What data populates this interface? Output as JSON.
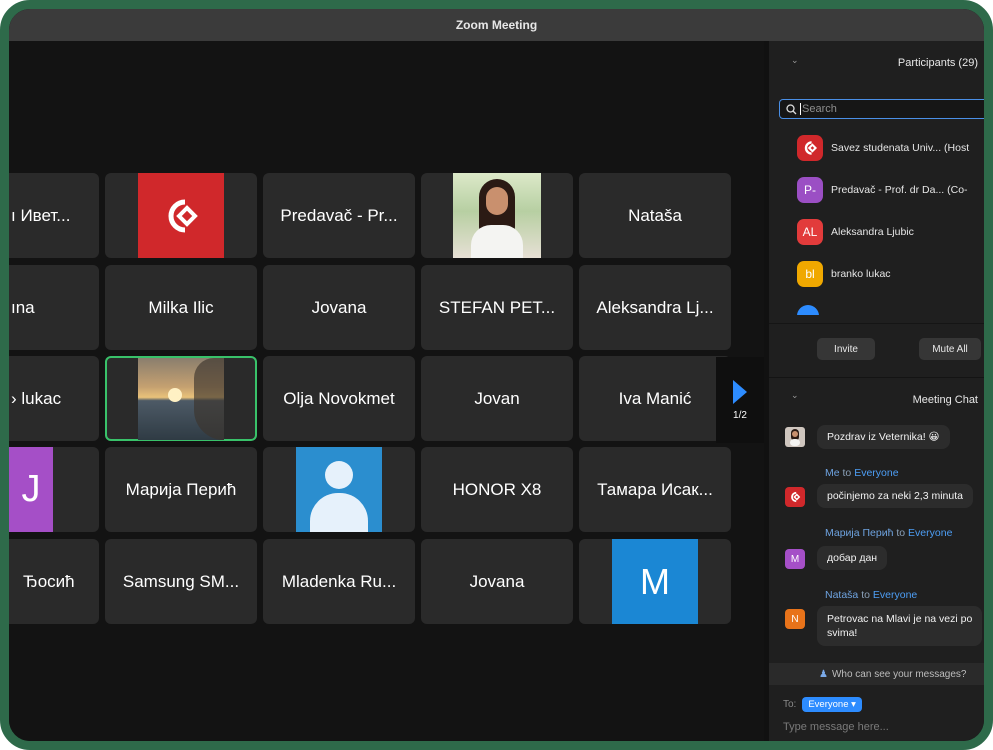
{
  "window": {
    "title": "Zoom Meeting"
  },
  "gallery": {
    "tiles": [
      {
        "label": "ı Ивет..."
      },
      {
        "label": ""
      },
      {
        "label": "Predavač - Pr..."
      },
      {
        "label": ""
      },
      {
        "label": "Nataša"
      },
      {
        "label": "ına"
      },
      {
        "label": "Milka Ilic"
      },
      {
        "label": "Jovana"
      },
      {
        "label": "STEFAN PET..."
      },
      {
        "label": "Aleksandra Lj..."
      },
      {
        "label": "› lukac"
      },
      {
        "label": ""
      },
      {
        "label": "Olja Novokmet"
      },
      {
        "label": "Jovan"
      },
      {
        "label": "Iva Manić"
      },
      {
        "label": "J"
      },
      {
        "label": "Марија Перић"
      },
      {
        "label": ""
      },
      {
        "label": "HONOR X8"
      },
      {
        "label": "Тамара Исак..."
      },
      {
        "label": "Ђосић"
      },
      {
        "label": "Samsung SM..."
      },
      {
        "label": "Mladenka Ru..."
      },
      {
        "label": "Jovana"
      },
      {
        "label": "M"
      }
    ],
    "pager": {
      "count": "1/2"
    }
  },
  "participants": {
    "title": "Participants (29)",
    "search_placeholder": "Search",
    "items": [
      {
        "initials": "",
        "name": "Savez studenata Univ... (Host",
        "color": "#d0282b"
      },
      {
        "initials": "P-",
        "name": "Predavač - Prof. dr Da... (Co-",
        "color": "#9b4fc4"
      },
      {
        "initials": "AL",
        "name": "Aleksandra Ljubic",
        "color": "#e23b3b"
      },
      {
        "initials": "bl",
        "name": "branko lukac",
        "color": "#f0a800"
      }
    ],
    "invite_label": "Invite",
    "mute_all_label": "Mute All"
  },
  "chat": {
    "title": "Meeting Chat",
    "messages": [
      {
        "text": "Pozdrav iz Veternika! 😀"
      },
      {
        "from": "Me",
        "to_word": "to",
        "target": "Everyone",
        "text": "počinjemo za neki 2,3 minuta"
      },
      {
        "from": "Марија Перић",
        "to_word": "to",
        "target": "Everyone",
        "text": "добар дан",
        "initial": "M"
      },
      {
        "from": "Nataša",
        "to_word": "to",
        "target": "Everyone",
        "text_line1": "Petrovac na Mlavi je na vezi po",
        "text_line2": "svima!",
        "initial": "N"
      }
    ],
    "notice": "Who can see your messages?",
    "to_label": "To:",
    "to_value": "Everyone ▾",
    "input_placeholder": "Type message here..."
  },
  "colors": {
    "frame": "#2e6a4a",
    "accent": "#2d8cff",
    "logo_red": "#d0282b"
  }
}
